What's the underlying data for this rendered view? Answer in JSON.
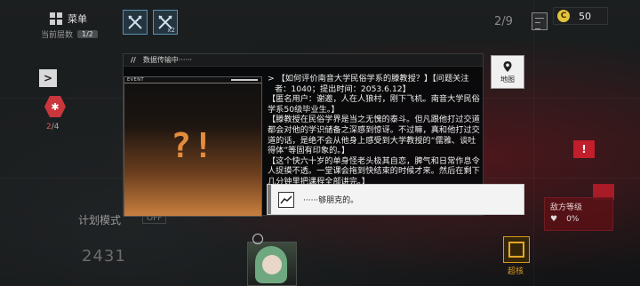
{
  "hud": {
    "menu_label": "菜单",
    "floor_label": "当前层数",
    "floor_value": "1/2",
    "skill_slots": [
      {
        "icon": "crossed-swords-icon",
        "sub": ""
      },
      {
        "icon": "crossed-swords-icon",
        "sub": "x2"
      }
    ],
    "page_count": "2/9",
    "coin_icon_letter": "C",
    "coin_amount": "50",
    "status_hits": "2",
    "status_total": "/4",
    "plan_mode_label": "计划模式",
    "plan_mode_state": "OFF",
    "score": "2431",
    "threat_label": "敌方等级",
    "threat_marks": [
      "♥",
      "0%"
    ],
    "red_tag_text": "!",
    "gold_label": "超核"
  },
  "dialog": {
    "header_title": "数据传输中······",
    "event_tag": "EVENT",
    "event_glyph": "?!",
    "story": [
      "> 【如何评价南音大学民俗学系的滕教授？】【问题关注者：1040；提出时间：2053.6.12】",
      "【匿名用户：谢邀，人在人狼村，刚下飞机。南音大学民俗学系50级毕业生。】",
      "【滕教授在民俗学界是当之无愧的泰斗。但凡跟他打过交道都会对他的学识储备之深感到惊讶。不过嘛，真和他打过交道的话，是绝不会从他身上感受到大学教授的“儒雅、谈吐得体”等固有印象的。】",
      "【这个快六十岁的单身怪老头极其自恋，脾气和日常作息令人捉摸不透。一堂课会拖到快结束的时候才来。然后在剩下几分钟里把课程全部讲完。】"
    ],
    "choice_text": "······够朋克的。"
  },
  "map_button": {
    "label": "地图"
  }
}
